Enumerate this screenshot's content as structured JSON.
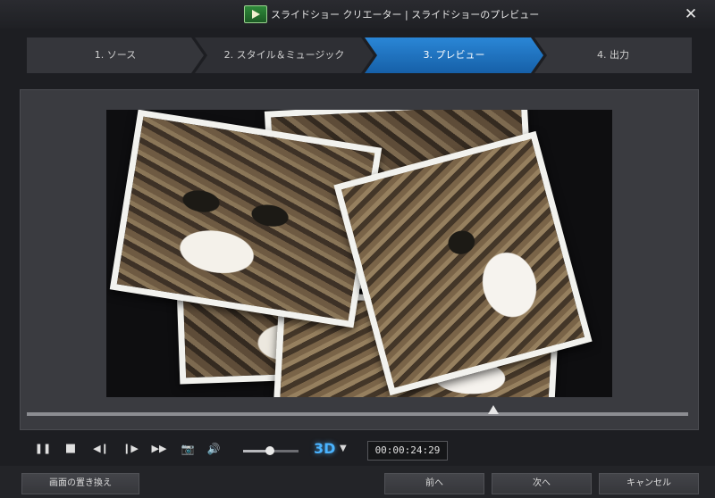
{
  "window": {
    "title": "スライドショー クリエーター | スライドショーのプレビュー",
    "close_glyph": "✕"
  },
  "steps": [
    {
      "label": "1. ソース",
      "active": false
    },
    {
      "label": "2. スタイル＆ミュージック",
      "active": false
    },
    {
      "label": "3. プレビュー",
      "active": true
    },
    {
      "label": "4. 出力",
      "active": false
    }
  ],
  "player": {
    "timeline_progress": 0.705,
    "volume_level": 0.48,
    "fps_value": "3D",
    "fps_arrow": "▼",
    "timecode": "00:00:24:29",
    "controls": {
      "pause": "❚❚",
      "stop": "■",
      "prev_frame": "◀❙",
      "next_frame": "❙▶",
      "fast_forward": "▶▶",
      "snapshot": "📷",
      "volume": "🔊"
    }
  },
  "buttons": {
    "swap": "画面の置き換え",
    "back": "前へ",
    "next": "次へ",
    "cancel": "キャンセル"
  },
  "colors": {
    "accent": "#1f75c7",
    "fps_text": "#4ab3ff"
  }
}
